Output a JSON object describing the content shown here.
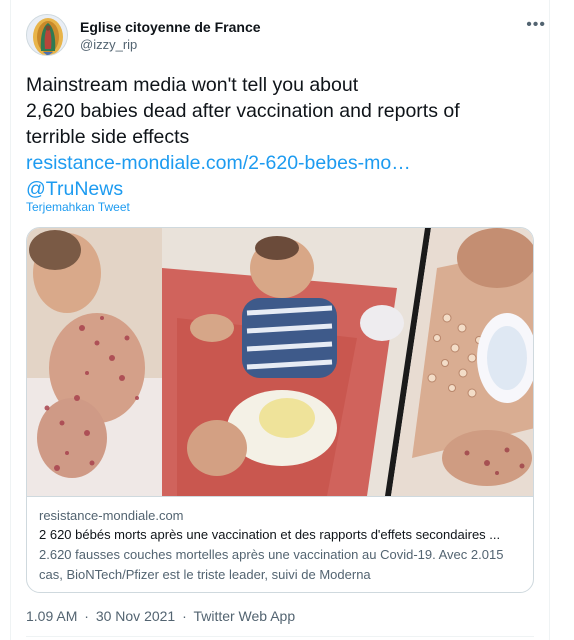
{
  "author": {
    "display_name": "Eglise citoyenne de France",
    "handle": "@izzy_rip",
    "avatar_icon": "virgin-mary-icon"
  },
  "menu_icon": "more-dots-icon",
  "tweet": {
    "lines": [
      "Mainstream media won't tell you about",
      "2,620 babies dead after vaccination and reports of",
      "terrible side effects"
    ],
    "link": "resistance-mondiale.com/2-620-bebes-mo…",
    "mention": "@TruNews",
    "translate": "Terjemahkan Tweet"
  },
  "card": {
    "domain": "resistance-mondiale.com",
    "title": "2 620 bébés morts après une vaccination et des rapports d'effets secondaires ...",
    "description": "2.620 fausses couches mortelles après une vaccination au Covid-19. Avec 2.015 cas, BioNTech/Pfizer est le triste leader, suivi de Moderna"
  },
  "meta": {
    "time": "1.09 AM",
    "separator": "·",
    "date": "30 Nov 2021",
    "source": "Twitter Web App"
  },
  "colors": {
    "link": "#1d9bf0",
    "text": "#0f1419",
    "secondary": "#536471",
    "border": "#cfd9de"
  }
}
